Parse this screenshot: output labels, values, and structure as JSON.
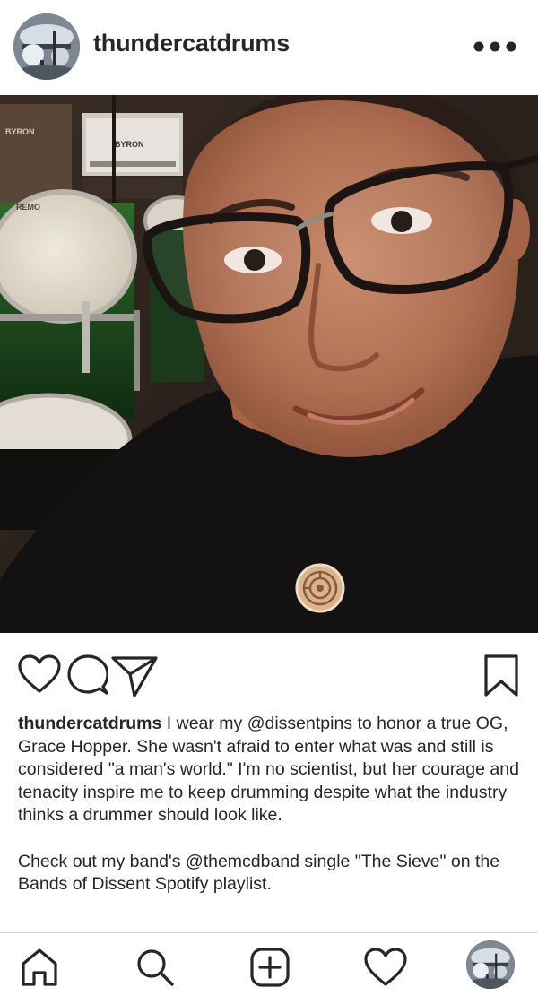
{
  "post": {
    "username": "thundercatdrums",
    "caption_paragraph_1": "I wear my @dissentpins to honor a true OG, Grace Hopper. She wasn't afraid to enter what was and still is considered \"a man's world.\" I'm no scientist, but her courage and tenacity inspire me to keep drumming despite what the industry thinks a drummer should look like.",
    "caption_paragraph_2": "Check out my band's @themcdband single \"The Sieve\" on the Bands of Dissent Spotify playlist.",
    "photo_text": {
      "amp_brand_1": "BYRON",
      "amp_brand_2": "BYRON",
      "drum_brand": "REMO"
    }
  },
  "icons": {
    "more": "more-horizontal-icon",
    "like": "heart-outline-icon",
    "comment": "comment-bubble-icon",
    "share": "paper-plane-icon",
    "save": "bookmark-icon",
    "home": "home-icon",
    "search": "search-icon",
    "add": "add-post-icon",
    "activity": "heart-outline-icon",
    "profile": "profile-avatar"
  },
  "colors": {
    "text": "#262626",
    "divider": "#dbdbdb",
    "background": "#ffffff"
  }
}
